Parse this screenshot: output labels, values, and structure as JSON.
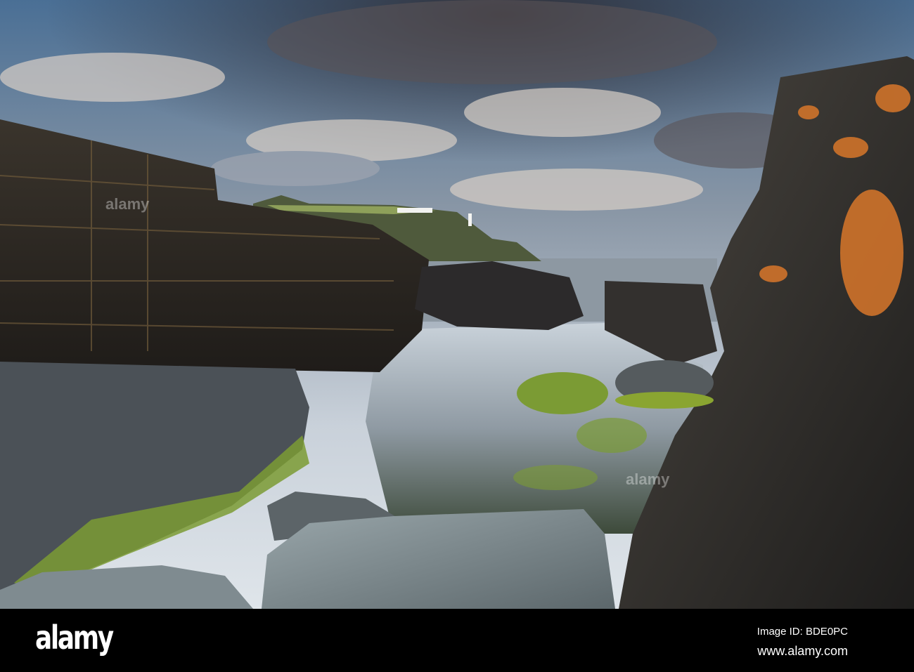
{
  "photo": {
    "subject": "Rock pool on rocky shore with headland and lighthouse under cloudy sky",
    "colors": {
      "sky_top": "#3f6a93",
      "sky_low": "#c8d3df",
      "sea": "#8e98a3",
      "rock_dark": "#2a2622",
      "lichen": "#d8772a",
      "algae": "#8aa531"
    }
  },
  "footer": {
    "logo": "alamy",
    "image_id": "Image ID: BDE0PC",
    "website": "www.alamy.com"
  },
  "watermark": "alamy"
}
